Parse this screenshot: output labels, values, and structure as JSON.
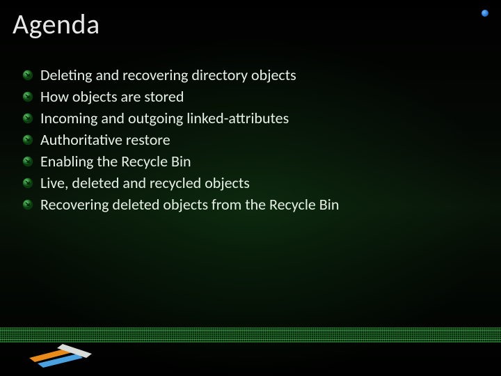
{
  "title": "Agenda",
  "bullets": [
    "Deleting and recovering directory objects",
    "How objects are stored",
    "Incoming and outgoing linked-attributes",
    "Authoritative restore",
    "Enabling the Recycle Bin",
    "Live, deleted and recycled objects",
    "Recovering deleted objects from the Recycle Bin"
  ]
}
